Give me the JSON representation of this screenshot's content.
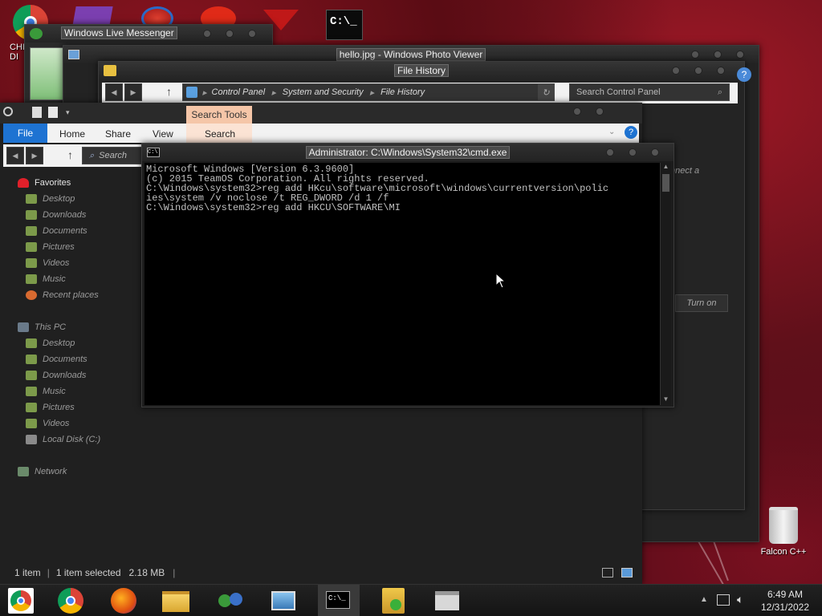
{
  "desktop": {
    "top_icon_label": "CHI\nDI",
    "recycle_bin_label": "Falcon C++"
  },
  "windows": {
    "messenger_title": "Windows Live Messenger",
    "photo_viewer_title": "hello.jpg - Windows Photo Viewer",
    "file_history": {
      "title": "File History",
      "breadcrumb": [
        "Control Panel",
        "System and Security",
        "File History"
      ],
      "search_placeholder": "Search Control Panel",
      "side_text": "nnect a",
      "turn_on_label": "Turn on"
    },
    "explorer": {
      "contextual_tab_label": "Search Tools",
      "tabs": [
        "File",
        "Home",
        "Share",
        "View",
        "Search"
      ],
      "search_placeholder": "Search",
      "nav": {
        "favorites_label": "Favorites",
        "favorites": [
          "Desktop",
          "Downloads",
          "Documents",
          "Pictures",
          "Videos",
          "Music",
          "Recent places"
        ],
        "thispc_label": "This PC",
        "thispc": [
          "Desktop",
          "Documents",
          "Downloads",
          "Music",
          "Pictures",
          "Videos",
          "Local Disk (C:)"
        ],
        "network_label": "Network"
      },
      "status": {
        "items": "1 item",
        "selected": "1 item selected",
        "size": "2.18 MB"
      }
    },
    "cmd": {
      "title": "Administrator: C:\\Windows\\System32\\cmd.exe",
      "icon_text": "C:\\",
      "lines": [
        "Microsoft Windows [Version 6.3.9600]",
        "(c) 2015 TeamOS Corporation. All rights reserved.",
        "",
        "C:\\Windows\\system32>reg add HKcu\\software\\microsoft\\windows\\currentversion\\polic",
        "ies\\system /v noclose /t REG_DWORD /d 1 /f",
        "",
        "C:\\Windows\\system32>reg add HKCU\\SOFTWARE\\MI"
      ]
    }
  },
  "taskbar": {
    "icons": [
      "chrome-icon",
      "chrome-icon",
      "firefox-icon",
      "file-explorer-icon",
      "messenger-icon",
      "photo-viewer-icon",
      "cmd-icon",
      "file-history-icon",
      "control-panel-icon"
    ],
    "clock_time": "6:49 AM",
    "clock_date": "12/31/2022",
    "cmd_icon_text": "C:\\_"
  },
  "colors": {
    "accent_blue": "#1e73d2",
    "search_tools_tab": "#f5c6a8",
    "favorites_heart": "#e0202a"
  }
}
